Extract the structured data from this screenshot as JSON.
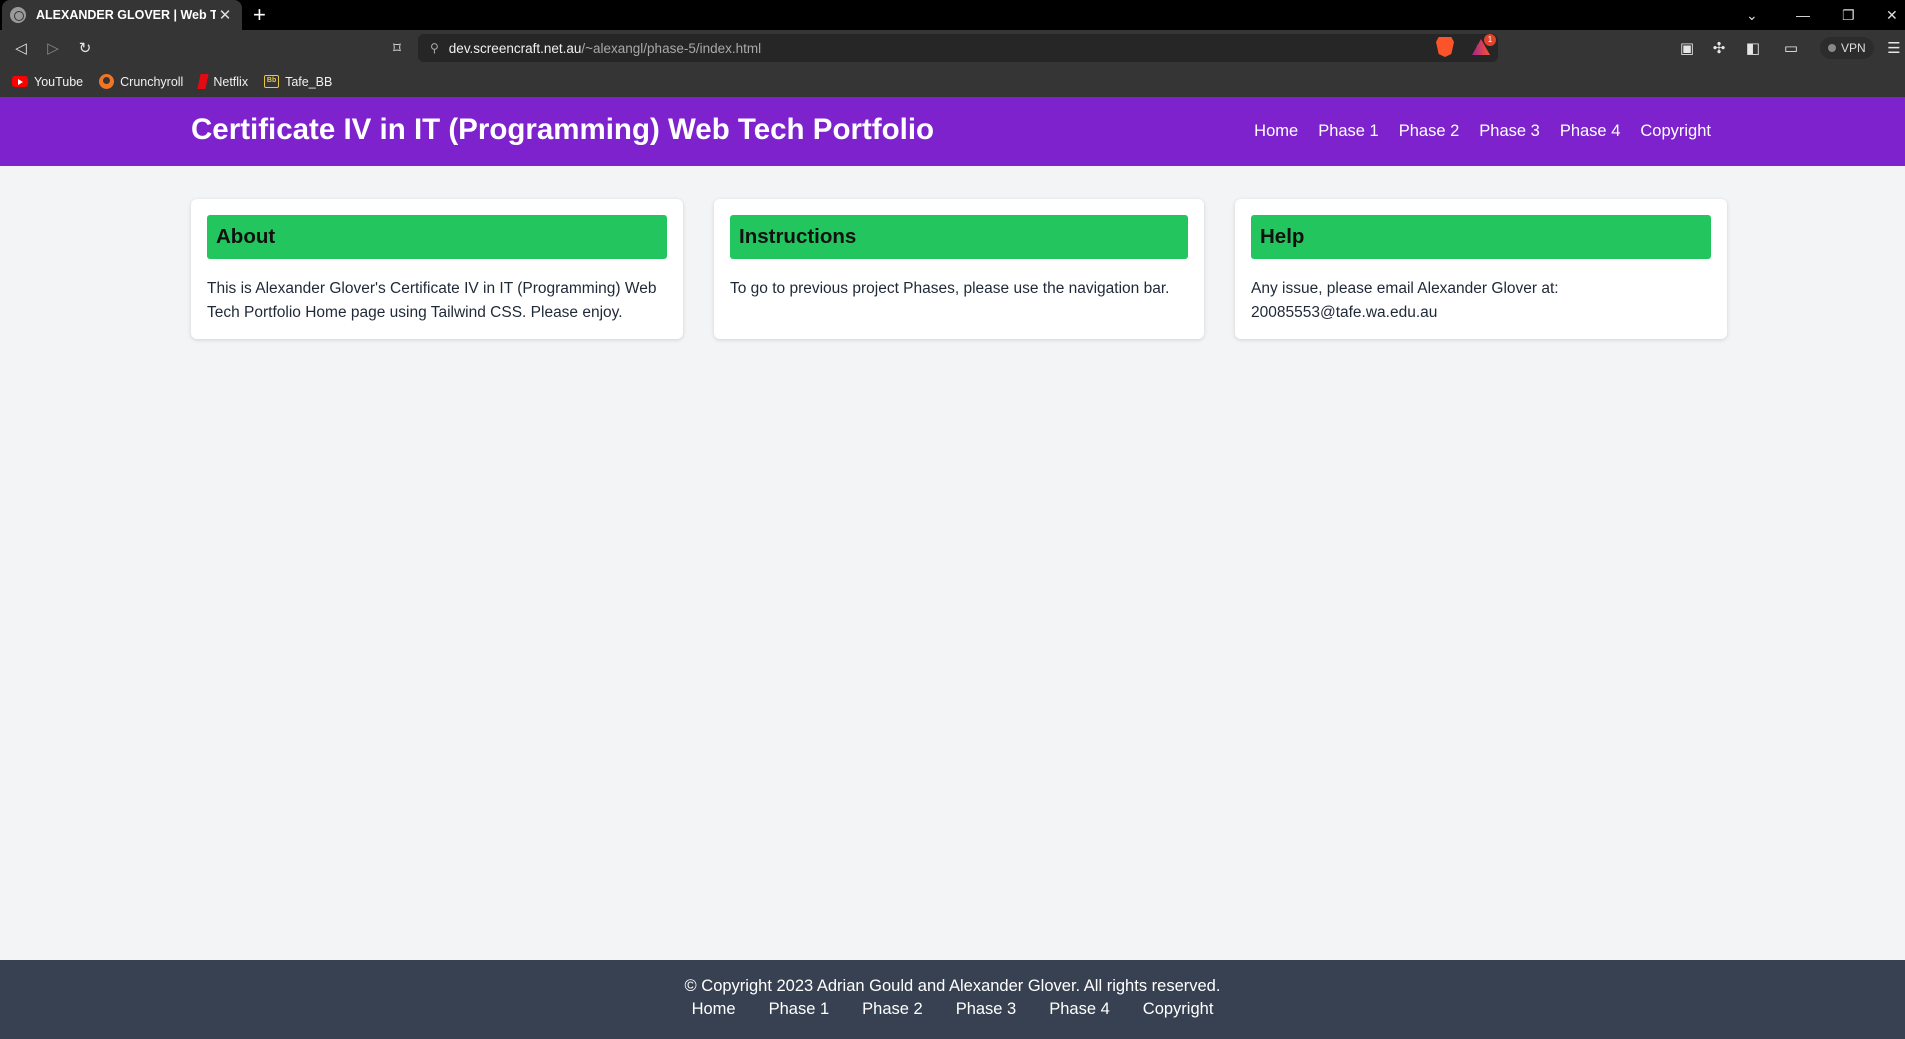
{
  "browser": {
    "tab_title": "ALEXANDER GLOVER | Web Tech",
    "url_host": "dev.screencraft.net.au",
    "url_path": "/~alexangl/phase-5/index.html",
    "vpn_label": "VPN",
    "rewards_badge": "1",
    "bookmarks": [
      "YouTube",
      "Crunchyroll",
      "Netflix",
      "Tafe_BB"
    ]
  },
  "header": {
    "title": "Certificate IV in IT (Programming) Web Tech Portfolio",
    "nav": [
      "Home",
      "Phase 1",
      "Phase 2",
      "Phase 3",
      "Phase 4",
      "Copyright"
    ]
  },
  "cards": [
    {
      "heading": "About",
      "text": "This is Alexander Glover's Certificate IV in IT (Programming) Web Tech Portfolio Home page using Tailwind CSS. Please enjoy."
    },
    {
      "heading": "Instructions",
      "text": "To go to previous project Phases, please use the navigation bar."
    },
    {
      "heading": "Help",
      "text": "Any issue, please email Alexander Glover at: 20085553@tafe.wa.edu.au"
    }
  ],
  "footer": {
    "copyright": "© Copyright 2023 Adrian Gould and Alexander Glover. All rights reserved.",
    "nav": [
      "Home",
      "Phase 1",
      "Phase 2",
      "Phase 3",
      "Phase 4",
      "Copyright"
    ]
  },
  "colors": {
    "header_bg": "#7e22ce",
    "card_heading_bg": "#22c55e",
    "footer_bg": "#374151",
    "page_bg": "#f3f4f6"
  }
}
